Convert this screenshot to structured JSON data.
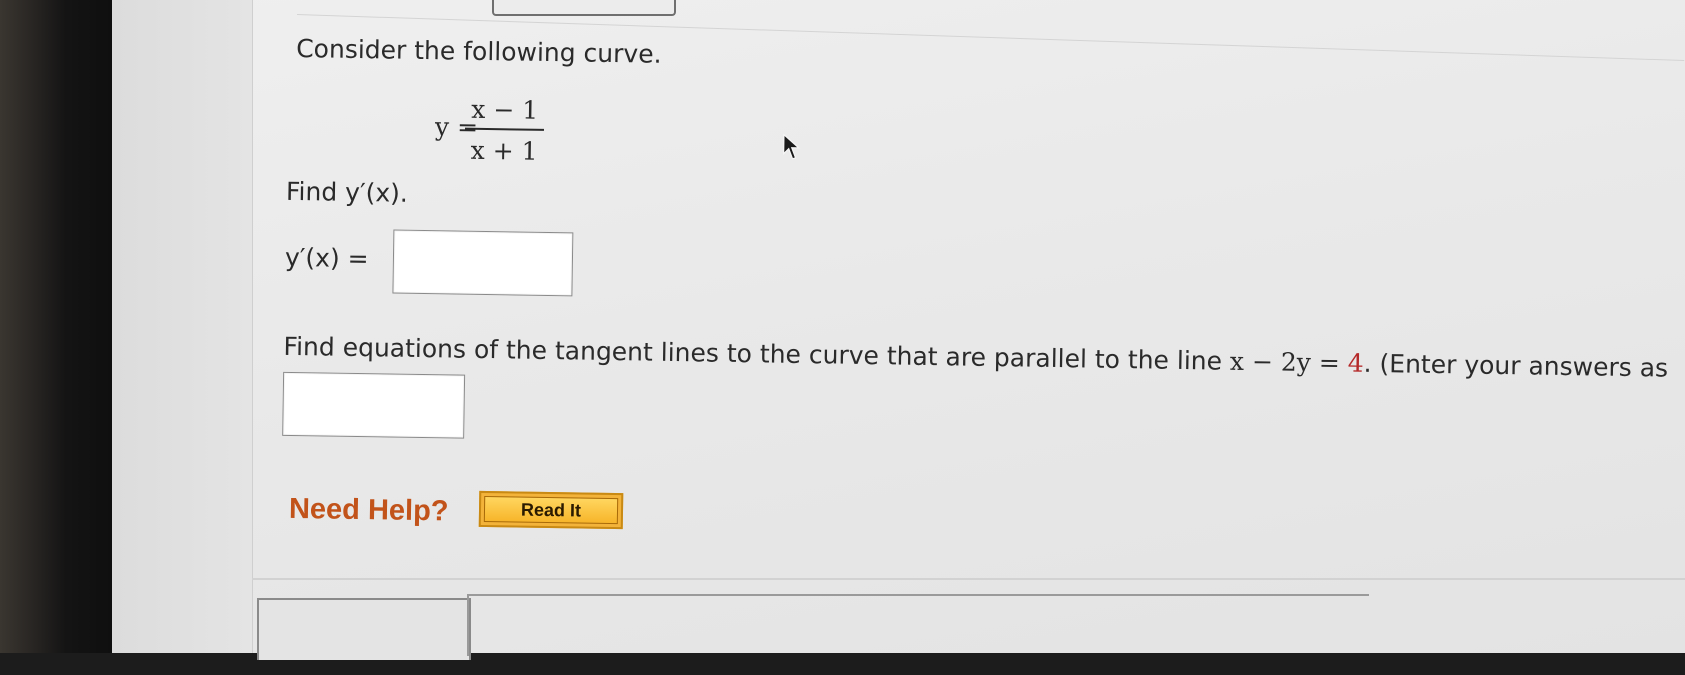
{
  "question": {
    "intro": "Consider the following curve.",
    "equation": {
      "lhs": "y =",
      "numerator": "x − 1",
      "denominator": "x + 1"
    },
    "part1_prompt": "Find y′(x).",
    "part1_label": "y′(x) =",
    "part1_answer": "",
    "part2_prompt_start": "Find equations of the tangent lines to the curve that are parallel to the line ",
    "part2_line": "x − 2y = 4",
    "part2_prompt_end": ". (Enter your answers as",
    "part2_answer": ""
  },
  "help": {
    "label": "Need Help?",
    "read_it": "Read It"
  },
  "colors": {
    "help_text": "#c2531a",
    "button_fill": "#f7b52a",
    "highlight_value": "#b52a2a"
  }
}
